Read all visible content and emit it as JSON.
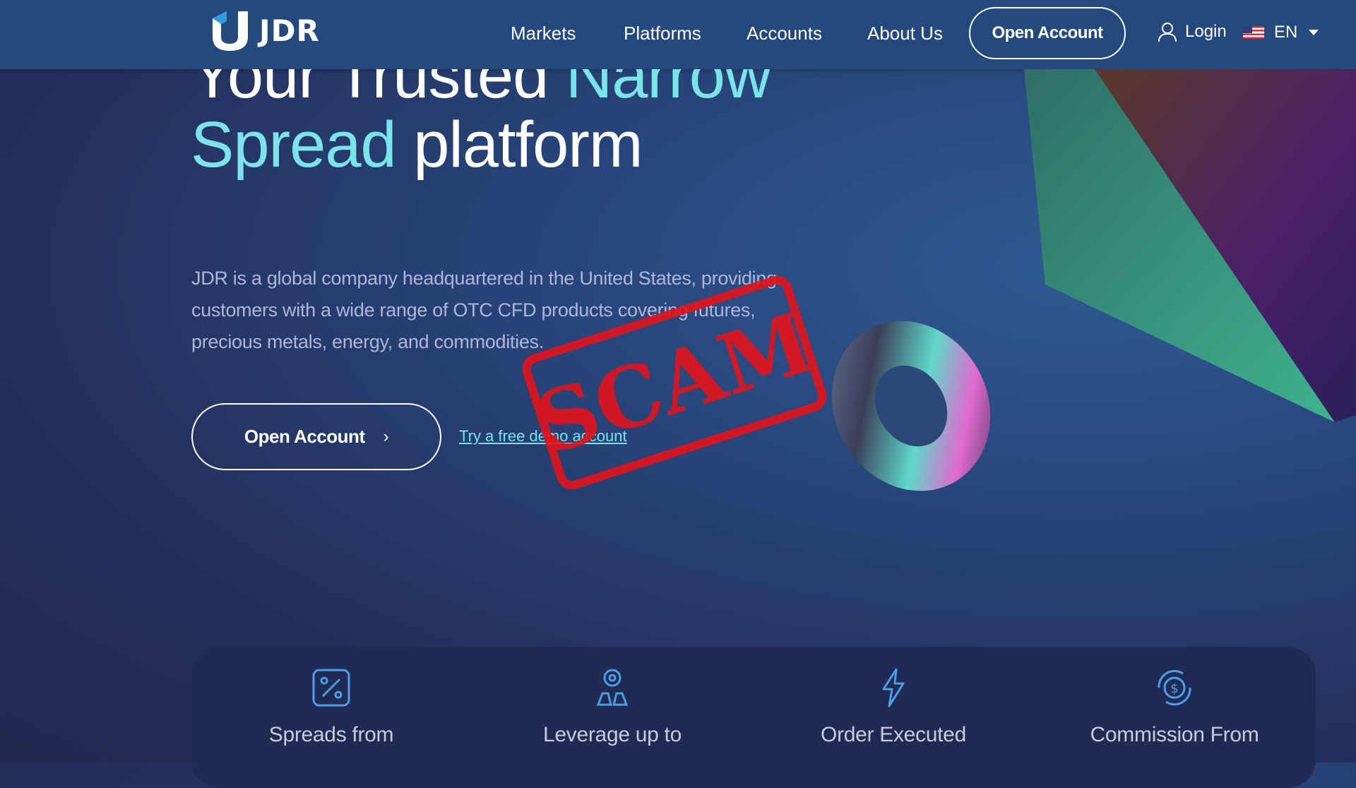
{
  "header": {
    "brand": "JDR",
    "nav": [
      "Markets",
      "Platforms",
      "Accounts",
      "About Us"
    ],
    "open_account": "Open Account",
    "login": "Login",
    "language": "EN"
  },
  "hero": {
    "headline_part1": "Your Trusted ",
    "headline_accent1": "Narrow",
    "headline_accent2": "Spread",
    "headline_part2": " platform",
    "description": "JDR is a global company headquartered in the United States, providing customers with a wide range of OTC CFD products covering futures, precious metals, energy, and commodities.",
    "cta_label": "Open Account",
    "demo_link": "Try a free demo account"
  },
  "stamp": {
    "text": "SCAM",
    "color": "#e0141e"
  },
  "features": [
    {
      "icon": "spread-icon",
      "label": "Spreads from"
    },
    {
      "icon": "leverage-icon",
      "label": "Leverage up to"
    },
    {
      "icon": "lightning-icon",
      "label": "Order Executed"
    },
    {
      "icon": "commission-icon",
      "label": "Commission From"
    }
  ],
  "colors": {
    "accent": "#7ae4ea",
    "header": "#24497d",
    "icon": "#4a9fe8"
  }
}
